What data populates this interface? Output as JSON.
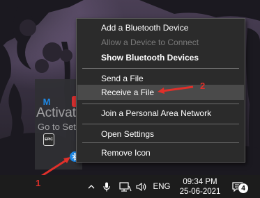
{
  "context_menu": {
    "items": [
      {
        "label": "Add a Bluetooth Device",
        "state": "normal"
      },
      {
        "label": "Allow a Device to Connect",
        "state": "disabled"
      },
      {
        "label": "Show Bluetooth Devices",
        "state": "bold"
      },
      {
        "label": "Send a File",
        "state": "normal"
      },
      {
        "label": "Receive a File",
        "state": "hover"
      },
      {
        "label": "Join a Personal Area Network",
        "state": "normal"
      },
      {
        "label": "Open Settings",
        "state": "normal"
      },
      {
        "label": "Remove Icon",
        "state": "normal"
      }
    ]
  },
  "watermark": {
    "title": "Activate Windows",
    "subtitle": "Go to Settings to activate Windows."
  },
  "tray_flyout": {
    "icons": [
      {
        "name": "malwarebytes-icon",
        "glyph": "M",
        "color": "#1565c0"
      },
      {
        "name": "red-app-icon",
        "glyph": "",
        "color": "#d32f2f"
      },
      {
        "name": "epic-games-icon",
        "glyph": "EPIC",
        "color": "#2b2b2b"
      },
      {
        "name": "bluetooth-icon",
        "glyph": "",
        "color": "#1e88e5"
      }
    ]
  },
  "annotations": {
    "step1": "1",
    "step2": "2",
    "color": "#e0302a"
  },
  "taskbar": {
    "language": "ENG",
    "time": "09:34 PM",
    "date": "25-06-2021",
    "notification_count": "4",
    "background": "#1c1c1c"
  }
}
